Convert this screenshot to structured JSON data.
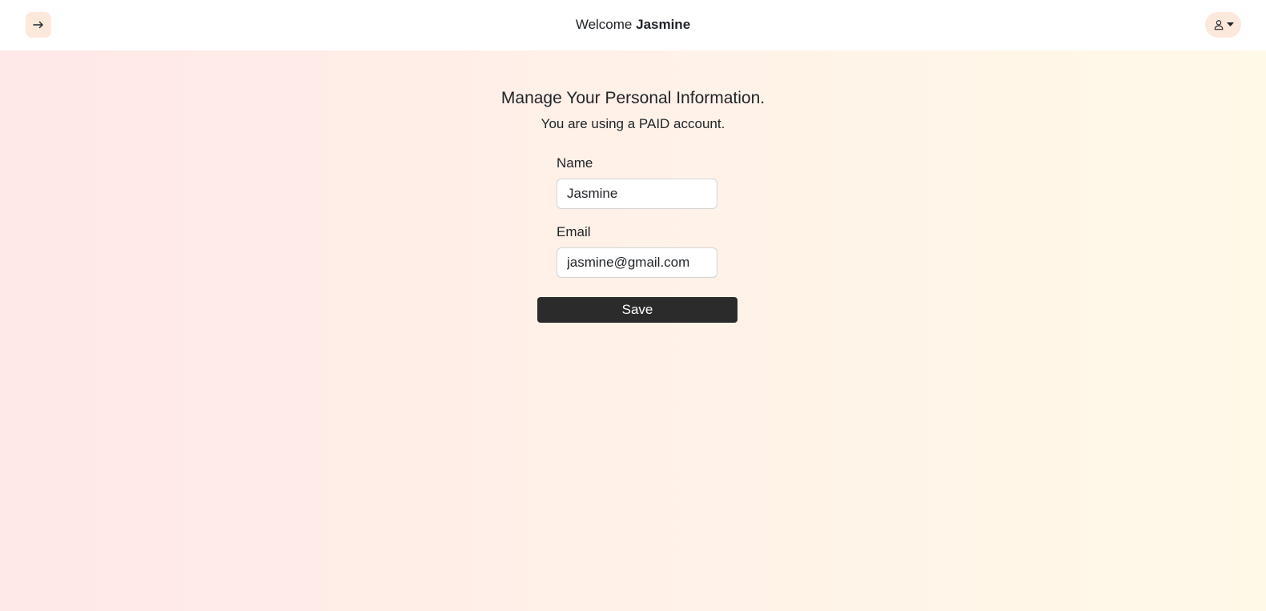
{
  "header": {
    "welcome_prefix": "Welcome",
    "user_name": "Jasmine",
    "nav_icon": "arrow-right-icon",
    "user_icon": "person-icon",
    "dropdown_icon": "caret-down-icon"
  },
  "main": {
    "title": "Manage Your Personal Information.",
    "subtitle": "You are using a PAID account."
  },
  "form": {
    "name_label": "Name",
    "name_value": "Jasmine",
    "email_label": "Email",
    "email_value": "jasmine@gmail.com",
    "save_label": "Save"
  },
  "colors": {
    "button_bg": "#2b2b2b",
    "icon_chip_bg": "#fde8dc",
    "gradient_start": "#ffe8e8",
    "gradient_end": "#fff9e8"
  }
}
